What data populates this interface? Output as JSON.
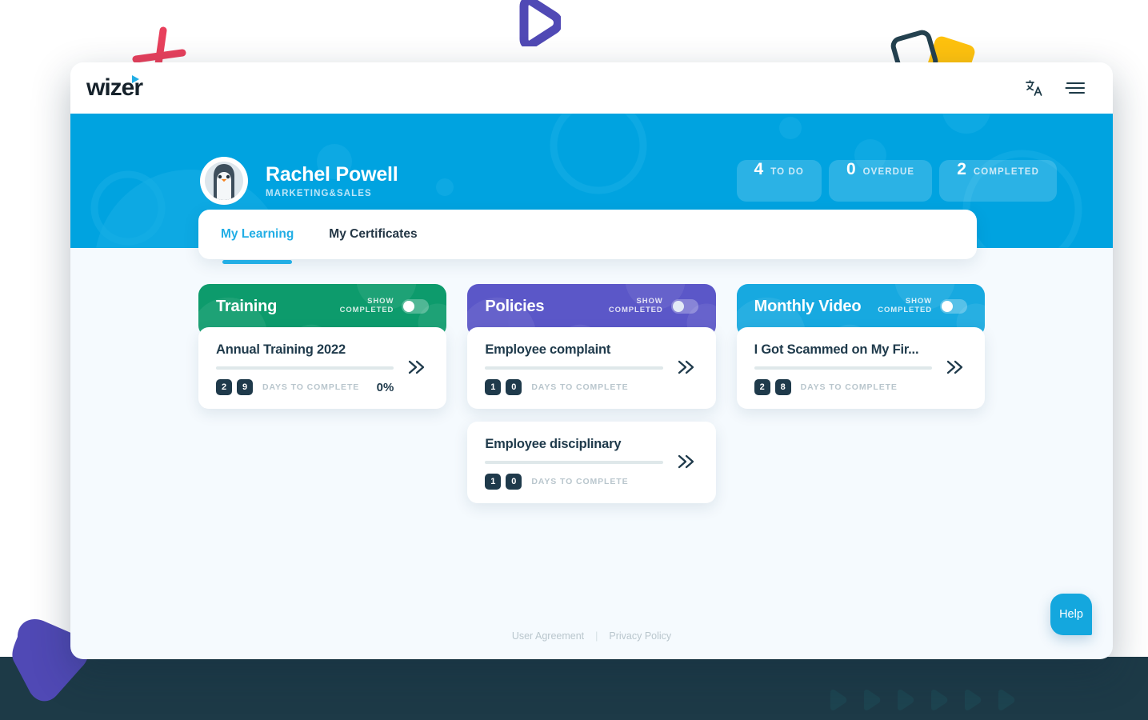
{
  "brand": {
    "name": "wizer",
    "logo_mark": "play-triangle-icon"
  },
  "topbar": {
    "translate_icon": "translate-icon",
    "menu_icon": "hamburger-menu-icon"
  },
  "hero": {
    "avatar": "penguin-avatar",
    "name": "Rachel Powell",
    "department": "MARKETING&SALES",
    "stats": [
      {
        "value": "4",
        "label": "TO DO"
      },
      {
        "value": "0",
        "label": "OVERDUE"
      },
      {
        "value": "2",
        "label": "COMPLETED"
      }
    ]
  },
  "tabs": [
    {
      "label": "My Learning",
      "active": true
    },
    {
      "label": "My Certificates",
      "active": false
    }
  ],
  "toggle_label": "SHOW\nCOMPLETED",
  "days_label": "DAYS TO COMPLETE",
  "columns": [
    {
      "title": "Training",
      "color": "#0D9B6C",
      "toggle_on": true,
      "cards": [
        {
          "title": "Annual Training 2022",
          "days": [
            "2",
            "9"
          ],
          "days_label": "DAYS TO COMPLETE",
          "percent": "0%",
          "progress": 0
        }
      ]
    },
    {
      "title": "Policies",
      "color": "#5B57C8",
      "toggle_on": false,
      "cards": [
        {
          "title": "Employee complaint",
          "days": [
            "1",
            "0"
          ],
          "days_label": "DAYS TO COMPLETE",
          "percent": "",
          "progress": 0
        },
        {
          "title": "Employee disciplinary",
          "days": [
            "1",
            "0"
          ],
          "days_label": "DAYS TO COMPLETE",
          "percent": "",
          "progress": 0
        }
      ]
    },
    {
      "title": "Monthly Video",
      "color": "#17A9E0",
      "toggle_on": true,
      "cards": [
        {
          "title": "I Got Scammed on My Fir...",
          "days": [
            "2",
            "8"
          ],
          "days_label": "DAYS TO COMPLETE",
          "percent": "",
          "progress": 0
        }
      ]
    }
  ],
  "footer": {
    "user_agreement": "User Agreement",
    "separator": "|",
    "privacy_policy": "Privacy Policy"
  },
  "help": {
    "label": "Help"
  },
  "colors": {
    "hero_blue": "#00A3E0",
    "accent": "#22AEE5",
    "training_green": "#0D9B6C",
    "policies_purple": "#5B57C8",
    "video_blue": "#17A9E0",
    "dark_text": "#1F3A4B",
    "page_bg": "#F5FAFE",
    "backdrop": "#1D3A47",
    "deco_cross": "#E8405C",
    "deco_yellow": "#FFC20E",
    "deco_purple": "#5049B5"
  }
}
